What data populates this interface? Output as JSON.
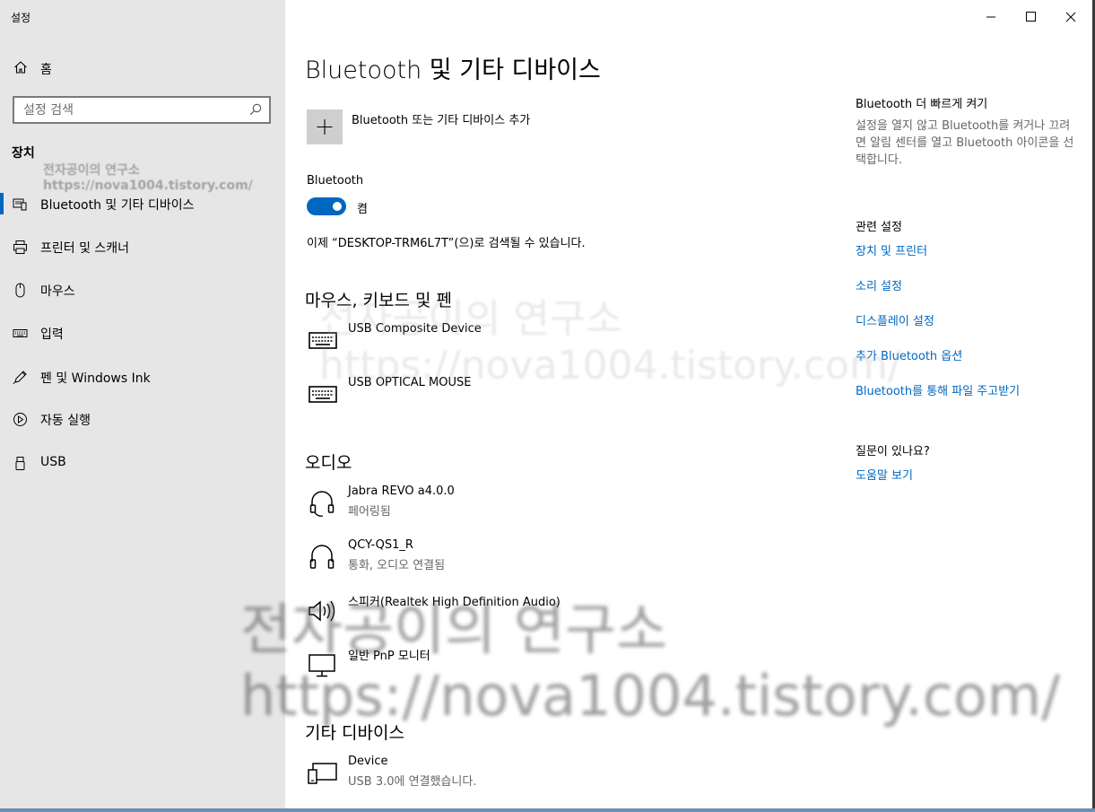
{
  "window": {
    "title": "설정"
  },
  "sidebar": {
    "home_label": "홈",
    "search_placeholder": "설정 검색",
    "section_title": "장치",
    "items": [
      {
        "label": "Bluetooth 및 기타 디바이스",
        "icon": "bluetooth-devices-icon",
        "selected": true
      },
      {
        "label": "프린터 및 스캐너",
        "icon": "printer-icon"
      },
      {
        "label": "마우스",
        "icon": "mouse-icon"
      },
      {
        "label": "입력",
        "icon": "keyboard-icon"
      },
      {
        "label": "펜 및 Windows Ink",
        "icon": "pen-icon"
      },
      {
        "label": "자동 실행",
        "icon": "autoplay-icon"
      },
      {
        "label": "USB",
        "icon": "usb-icon"
      }
    ]
  },
  "watermark": {
    "line1": "전자공이의 연구소",
    "line2": "https://nova1004.tistory.com/"
  },
  "main": {
    "title": "Bluetooth 및 기타 디바이스",
    "add_device_label": "Bluetooth 또는 기타 디바이스 추가",
    "bluetooth_label": "Bluetooth",
    "toggle_state": "켬",
    "discoverable_text": "이제 “DESKTOP-TRM6L7T”(으)로 검색될 수 있습니다.",
    "groups": [
      {
        "title": "마우스, 키보드 및 펜",
        "devices": [
          {
            "name": "USB Composite Device",
            "status": "",
            "icon": "keyboard-icon"
          },
          {
            "name": "USB OPTICAL MOUSE",
            "status": "",
            "icon": "keyboard-icon"
          }
        ]
      },
      {
        "title": "오디오",
        "devices": [
          {
            "name": "Jabra REVO a4.0.0",
            "status": "페어링됨",
            "icon": "headset-icon"
          },
          {
            "name": "QCY-QS1_R",
            "status": "통화, 오디오 연결됨",
            "icon": "headphones-icon"
          },
          {
            "name": "스피커(Realtek High Definition Audio)",
            "status": "",
            "icon": "speaker-icon"
          },
          {
            "name": "일반 PnP 모니터",
            "status": "",
            "icon": "monitor-icon"
          }
        ]
      },
      {
        "title": "기타 디바이스",
        "devices": [
          {
            "name": "Device",
            "status": "USB 3.0에 연결했습니다.",
            "icon": "generic-device-icon"
          }
        ]
      }
    ]
  },
  "right": {
    "faster_title": "Bluetooth 더 빠르게 켜기",
    "faster_text": "설정을 열지 않고 Bluetooth를 켜거나 끄려면 알림 센터를 열고 Bluetooth 아이콘을 선택합니다.",
    "related_title": "관련 설정",
    "related_links": [
      "장치 및 프린터",
      "소리 설정",
      "디스플레이 설정",
      "추가 Bluetooth 옵션",
      "Bluetooth를 통해 파일 주고받기"
    ],
    "question_title": "질문이 있나요?",
    "help_link": "도움말 보기"
  },
  "colors": {
    "accent": "#0067c0",
    "sidebar_bg": "#e6e6e6"
  }
}
